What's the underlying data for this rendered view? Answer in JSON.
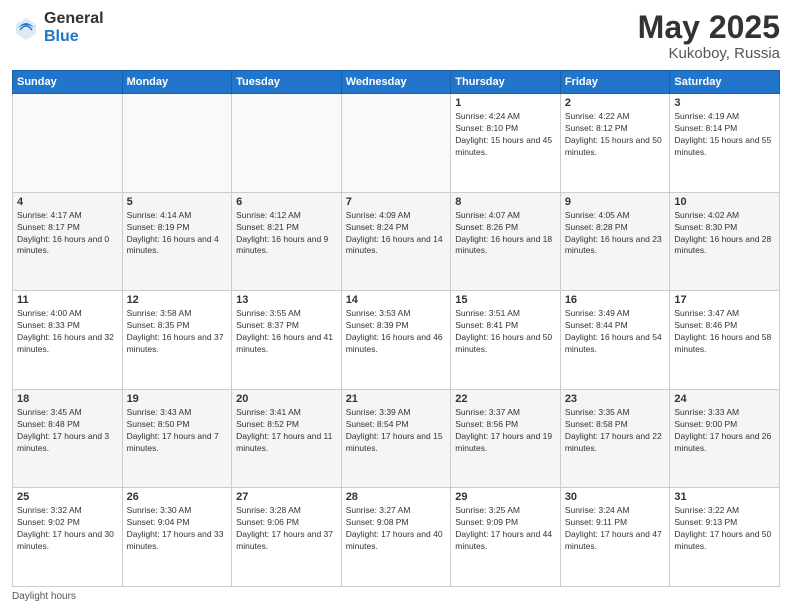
{
  "logo": {
    "general": "General",
    "blue": "Blue"
  },
  "title": {
    "month": "May 2025",
    "location": "Kukoboy, Russia"
  },
  "days_of_week": [
    "Sunday",
    "Monday",
    "Tuesday",
    "Wednesday",
    "Thursday",
    "Friday",
    "Saturday"
  ],
  "footer": {
    "daylight_label": "Daylight hours"
  },
  "weeks": [
    [
      {
        "day": "",
        "sunrise": "",
        "sunset": "",
        "daylight": ""
      },
      {
        "day": "",
        "sunrise": "",
        "sunset": "",
        "daylight": ""
      },
      {
        "day": "",
        "sunrise": "",
        "sunset": "",
        "daylight": ""
      },
      {
        "day": "",
        "sunrise": "",
        "sunset": "",
        "daylight": ""
      },
      {
        "day": "1",
        "sunrise": "Sunrise: 4:24 AM",
        "sunset": "Sunset: 8:10 PM",
        "daylight": "Daylight: 15 hours and 45 minutes."
      },
      {
        "day": "2",
        "sunrise": "Sunrise: 4:22 AM",
        "sunset": "Sunset: 8:12 PM",
        "daylight": "Daylight: 15 hours and 50 minutes."
      },
      {
        "day": "3",
        "sunrise": "Sunrise: 4:19 AM",
        "sunset": "Sunset: 8:14 PM",
        "daylight": "Daylight: 15 hours and 55 minutes."
      }
    ],
    [
      {
        "day": "4",
        "sunrise": "Sunrise: 4:17 AM",
        "sunset": "Sunset: 8:17 PM",
        "daylight": "Daylight: 16 hours and 0 minutes."
      },
      {
        "day": "5",
        "sunrise": "Sunrise: 4:14 AM",
        "sunset": "Sunset: 8:19 PM",
        "daylight": "Daylight: 16 hours and 4 minutes."
      },
      {
        "day": "6",
        "sunrise": "Sunrise: 4:12 AM",
        "sunset": "Sunset: 8:21 PM",
        "daylight": "Daylight: 16 hours and 9 minutes."
      },
      {
        "day": "7",
        "sunrise": "Sunrise: 4:09 AM",
        "sunset": "Sunset: 8:24 PM",
        "daylight": "Daylight: 16 hours and 14 minutes."
      },
      {
        "day": "8",
        "sunrise": "Sunrise: 4:07 AM",
        "sunset": "Sunset: 8:26 PM",
        "daylight": "Daylight: 16 hours and 18 minutes."
      },
      {
        "day": "9",
        "sunrise": "Sunrise: 4:05 AM",
        "sunset": "Sunset: 8:28 PM",
        "daylight": "Daylight: 16 hours and 23 minutes."
      },
      {
        "day": "10",
        "sunrise": "Sunrise: 4:02 AM",
        "sunset": "Sunset: 8:30 PM",
        "daylight": "Daylight: 16 hours and 28 minutes."
      }
    ],
    [
      {
        "day": "11",
        "sunrise": "Sunrise: 4:00 AM",
        "sunset": "Sunset: 8:33 PM",
        "daylight": "Daylight: 16 hours and 32 minutes."
      },
      {
        "day": "12",
        "sunrise": "Sunrise: 3:58 AM",
        "sunset": "Sunset: 8:35 PM",
        "daylight": "Daylight: 16 hours and 37 minutes."
      },
      {
        "day": "13",
        "sunrise": "Sunrise: 3:55 AM",
        "sunset": "Sunset: 8:37 PM",
        "daylight": "Daylight: 16 hours and 41 minutes."
      },
      {
        "day": "14",
        "sunrise": "Sunrise: 3:53 AM",
        "sunset": "Sunset: 8:39 PM",
        "daylight": "Daylight: 16 hours and 46 minutes."
      },
      {
        "day": "15",
        "sunrise": "Sunrise: 3:51 AM",
        "sunset": "Sunset: 8:41 PM",
        "daylight": "Daylight: 16 hours and 50 minutes."
      },
      {
        "day": "16",
        "sunrise": "Sunrise: 3:49 AM",
        "sunset": "Sunset: 8:44 PM",
        "daylight": "Daylight: 16 hours and 54 minutes."
      },
      {
        "day": "17",
        "sunrise": "Sunrise: 3:47 AM",
        "sunset": "Sunset: 8:46 PM",
        "daylight": "Daylight: 16 hours and 58 minutes."
      }
    ],
    [
      {
        "day": "18",
        "sunrise": "Sunrise: 3:45 AM",
        "sunset": "Sunset: 8:48 PM",
        "daylight": "Daylight: 17 hours and 3 minutes."
      },
      {
        "day": "19",
        "sunrise": "Sunrise: 3:43 AM",
        "sunset": "Sunset: 8:50 PM",
        "daylight": "Daylight: 17 hours and 7 minutes."
      },
      {
        "day": "20",
        "sunrise": "Sunrise: 3:41 AM",
        "sunset": "Sunset: 8:52 PM",
        "daylight": "Daylight: 17 hours and 11 minutes."
      },
      {
        "day": "21",
        "sunrise": "Sunrise: 3:39 AM",
        "sunset": "Sunset: 8:54 PM",
        "daylight": "Daylight: 17 hours and 15 minutes."
      },
      {
        "day": "22",
        "sunrise": "Sunrise: 3:37 AM",
        "sunset": "Sunset: 8:56 PM",
        "daylight": "Daylight: 17 hours and 19 minutes."
      },
      {
        "day": "23",
        "sunrise": "Sunrise: 3:35 AM",
        "sunset": "Sunset: 8:58 PM",
        "daylight": "Daylight: 17 hours and 22 minutes."
      },
      {
        "day": "24",
        "sunrise": "Sunrise: 3:33 AM",
        "sunset": "Sunset: 9:00 PM",
        "daylight": "Daylight: 17 hours and 26 minutes."
      }
    ],
    [
      {
        "day": "25",
        "sunrise": "Sunrise: 3:32 AM",
        "sunset": "Sunset: 9:02 PM",
        "daylight": "Daylight: 17 hours and 30 minutes."
      },
      {
        "day": "26",
        "sunrise": "Sunrise: 3:30 AM",
        "sunset": "Sunset: 9:04 PM",
        "daylight": "Daylight: 17 hours and 33 minutes."
      },
      {
        "day": "27",
        "sunrise": "Sunrise: 3:28 AM",
        "sunset": "Sunset: 9:06 PM",
        "daylight": "Daylight: 17 hours and 37 minutes."
      },
      {
        "day": "28",
        "sunrise": "Sunrise: 3:27 AM",
        "sunset": "Sunset: 9:08 PM",
        "daylight": "Daylight: 17 hours and 40 minutes."
      },
      {
        "day": "29",
        "sunrise": "Sunrise: 3:25 AM",
        "sunset": "Sunset: 9:09 PM",
        "daylight": "Daylight: 17 hours and 44 minutes."
      },
      {
        "day": "30",
        "sunrise": "Sunrise: 3:24 AM",
        "sunset": "Sunset: 9:11 PM",
        "daylight": "Daylight: 17 hours and 47 minutes."
      },
      {
        "day": "31",
        "sunrise": "Sunrise: 3:22 AM",
        "sunset": "Sunset: 9:13 PM",
        "daylight": "Daylight: 17 hours and 50 minutes."
      }
    ]
  ]
}
